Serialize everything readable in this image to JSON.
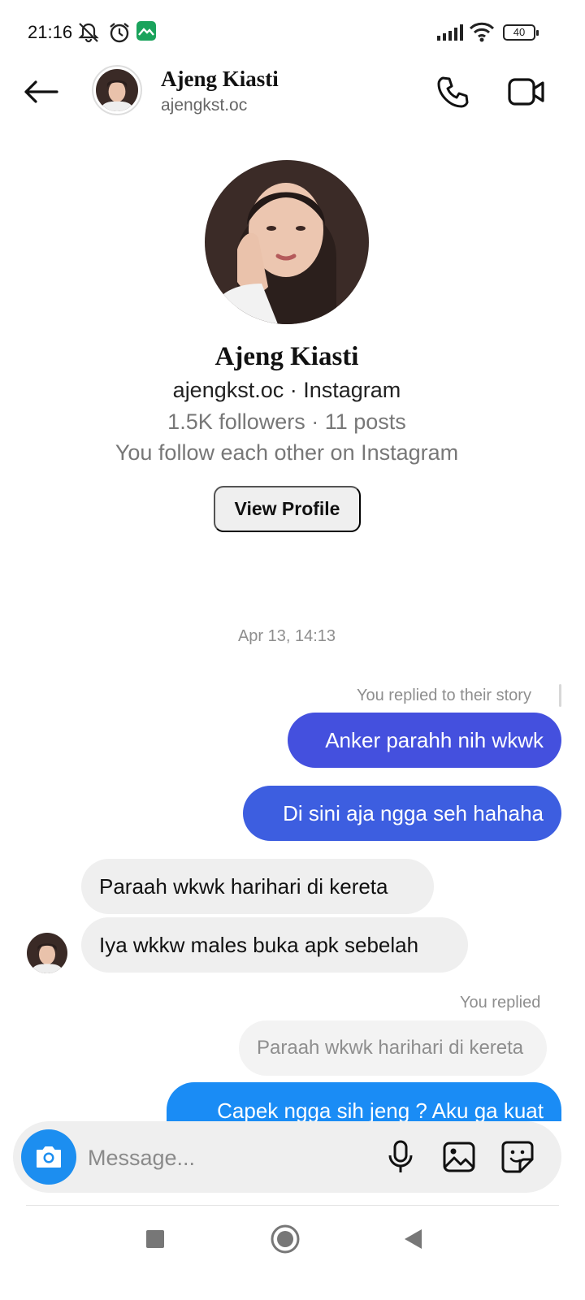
{
  "status_bar": {
    "time": "21:16",
    "battery": "40",
    "icons": [
      "notifications-off-icon",
      "alarm-icon",
      "app-notification-icon",
      "signal-icon",
      "wifi-icon",
      "battery-icon"
    ]
  },
  "header": {
    "name": "Ajeng Kiasti",
    "username": "ajengkst.oc"
  },
  "profile": {
    "name": "Ajeng Kiasti",
    "subtitle": "ajengkst.oc · Instagram",
    "stats": "1.5K followers · 11 posts",
    "relation": "You follow each other on Instagram",
    "view_button": "View Profile"
  },
  "conversation": {
    "timestamp": "Apr 13, 14:13",
    "story_reply_label": "You replied to their story",
    "reply_label": "You replied",
    "messages": [
      {
        "from": "me",
        "text": "Anker parahh nih wkwk",
        "color": "#4450de"
      },
      {
        "from": "me",
        "text": "Di sini aja ngga seh hahaha",
        "color": "#3d5ee0"
      },
      {
        "from": "them",
        "text": "Paraah wkwk harihari di kereta"
      },
      {
        "from": "them",
        "text": "Iya wkkw males buka apk sebelah"
      },
      {
        "from": "quote",
        "text": "Paraah wkwk harihari di kereta"
      },
      {
        "from": "me",
        "text": "Capek ngga sih jeng ? Aku ga kuat",
        "color": "#1a8cf5"
      }
    ]
  },
  "composer": {
    "placeholder": "Message..."
  },
  "colors": {
    "camera_button": "#1c8ef0",
    "status_app_icon": "#1aa35c"
  }
}
